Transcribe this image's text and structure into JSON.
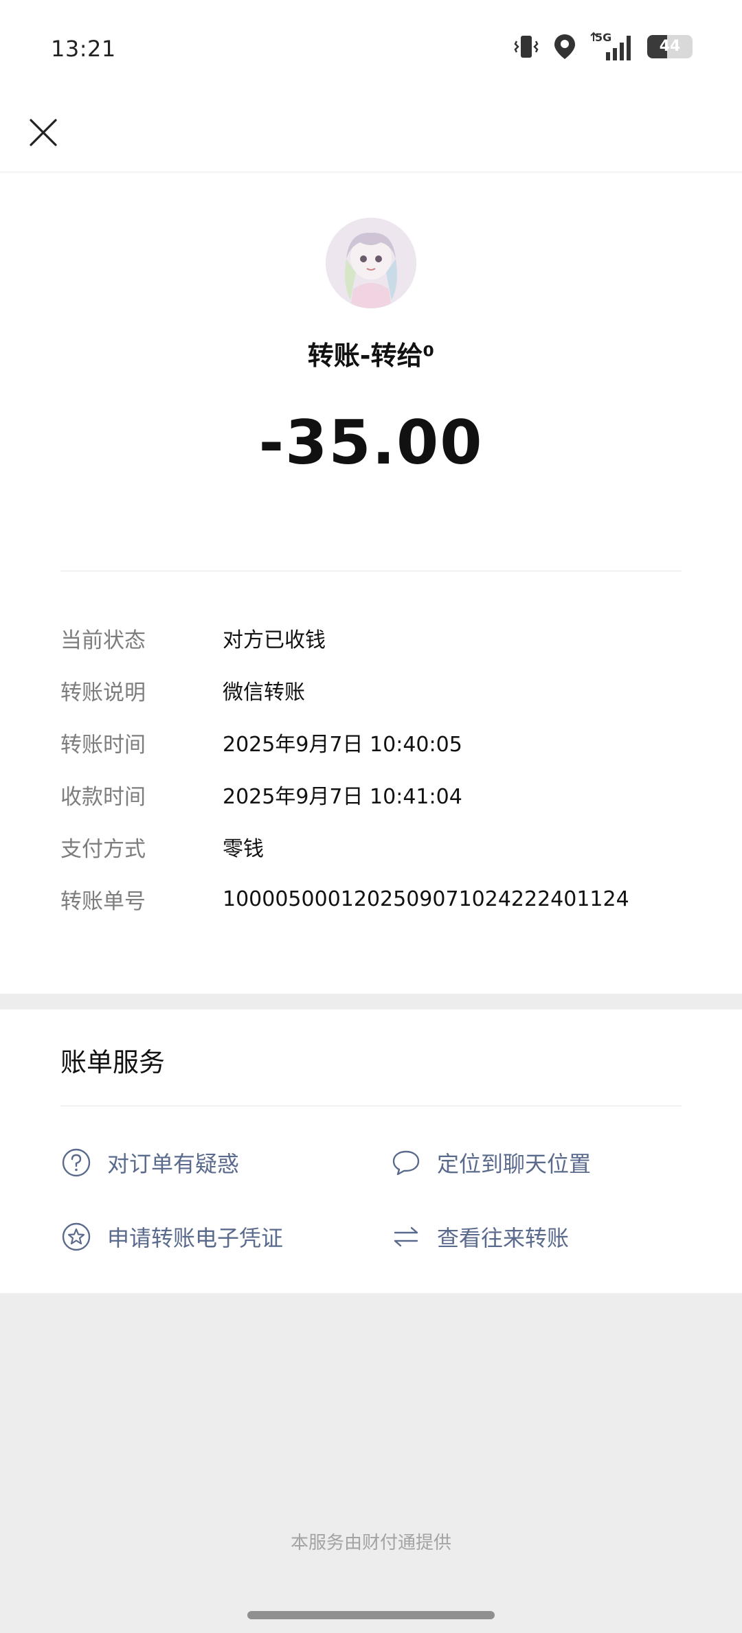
{
  "status_bar": {
    "time": "13:21",
    "network": "5G",
    "battery": "44"
  },
  "header": {
    "close_icon": "close-icon"
  },
  "transfer": {
    "title": "转账-转给⁰",
    "amount": "-35.00"
  },
  "details": [
    {
      "label": "当前状态",
      "value": "对方已收钱"
    },
    {
      "label": "转账说明",
      "value": "微信转账"
    },
    {
      "label": "转账时间",
      "value": "2025年9月7日  10:40:05"
    },
    {
      "label": "收款时间",
      "value": "2025年9月7日  10:41:04"
    },
    {
      "label": "支付方式",
      "value": "零钱"
    },
    {
      "label": "转账单号",
      "value": "1000050001202509071024222401124"
    }
  ],
  "services": {
    "title": "账单服务",
    "items": [
      {
        "label": "对订单有疑惑",
        "icon": "question-circle-icon"
      },
      {
        "label": "定位到聊天位置",
        "icon": "chat-bubble-icon"
      },
      {
        "label": "申请转账电子凭证",
        "icon": "star-circle-icon"
      },
      {
        "label": "查看往来转账",
        "icon": "swap-arrows-icon"
      }
    ]
  },
  "footer": {
    "provider_text": "本服务由财付通提供"
  },
  "colors": {
    "link": "#5a6a8c",
    "label": "#7d7d7d",
    "background": "#ededed"
  }
}
